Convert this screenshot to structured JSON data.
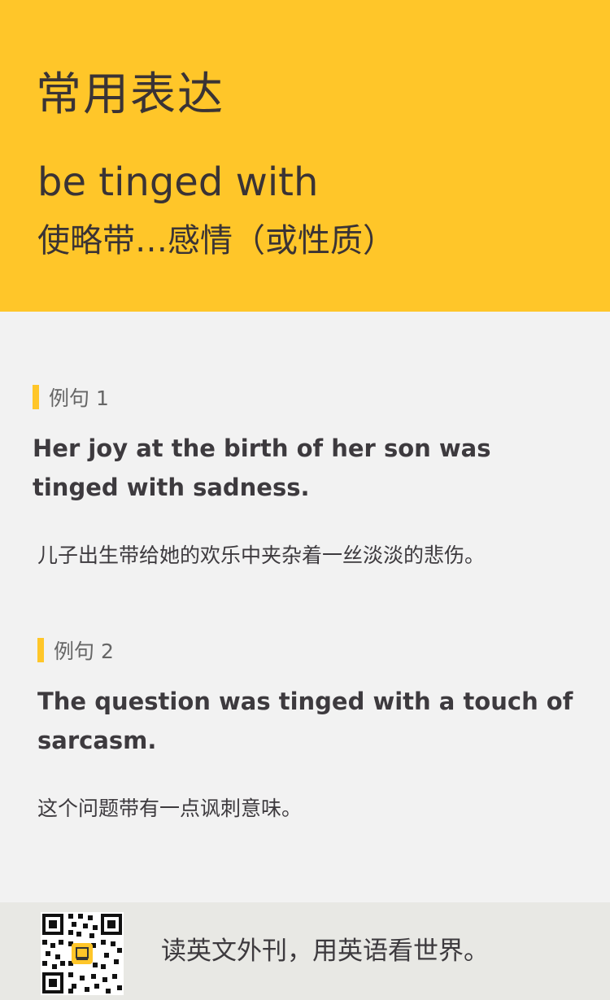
{
  "header": {
    "title": "常用表达",
    "phrase": "be tinged with",
    "meaning": "使略带…感情（或性质）"
  },
  "examples": [
    {
      "label": "例句 1",
      "english": "Her joy at the birth of her son was tinged with sadness.",
      "chinese": "儿子出生带给她的欢乐中夹杂着一丝淡淡的悲伤。"
    },
    {
      "label": "例句 2",
      "english": "The question was tinged with a touch of sarcasm.",
      "chinese": "这个问题带有一点讽刺意味。"
    }
  ],
  "footer": {
    "slogan": "读英文外刊，用英语看世界。",
    "qr_icon": "qr-code-icon"
  },
  "colors": {
    "accent": "#ffc629",
    "background": "#f2f2f2",
    "footer_bg": "#e8e8e4",
    "text": "#3d3a3e"
  }
}
